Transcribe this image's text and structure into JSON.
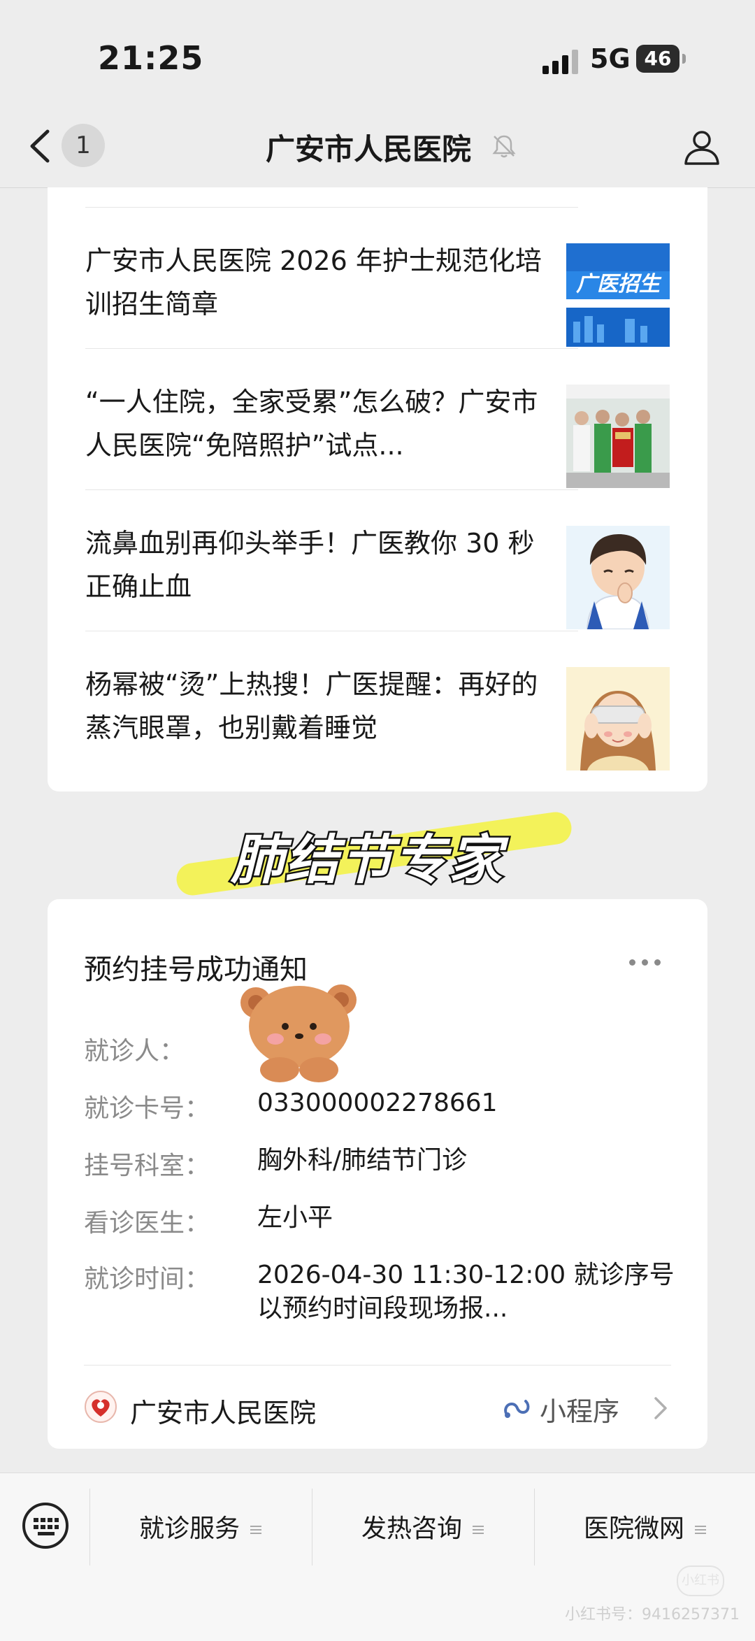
{
  "status_bar": {
    "time": "21:25",
    "network": "5G",
    "battery": "46"
  },
  "nav": {
    "unread_count": "1",
    "title": "广安市人民医院"
  },
  "articles": [
    {
      "title": "广安市人民医院 2026 年护士规范化培训招生简章",
      "thumb_text": "广医招生"
    },
    {
      "title": "“一人住院，全家受累”怎么破？广安市人民医院“免陪照护”试点..."
    },
    {
      "title": "流鼻血别再仰头举手！广医教你 30 秒正确止血"
    },
    {
      "title": "杨幂被“烫”上热搜！广医提醒：再好的蒸汽眼罩，也别戴着睡觉"
    }
  ],
  "caption": "肺结节专家",
  "notification": {
    "title": "预约挂号成功通知",
    "fields": [
      {
        "label": "就诊人：",
        "value": ""
      },
      {
        "label": "就诊卡号：",
        "value": "033000002278661"
      },
      {
        "label": "挂号科室：",
        "value": "胸外科/肺结节门诊"
      },
      {
        "label": "看诊医生：",
        "value": "左小平"
      },
      {
        "label": "就诊时间：",
        "value": "2026-04-30 11:30-12:00 就诊序号以预约时间段现场报..."
      }
    ],
    "mini_program_name": "广安市人民医院",
    "mini_program_label": "小程序"
  },
  "bottom_menu": [
    {
      "label": "就诊服务"
    },
    {
      "label": "发热咨询"
    },
    {
      "label": "医院微网"
    }
  ],
  "watermark": "小红书号：9416257371",
  "watermark_logo": "小红书",
  "colors": {
    "background": "#ededed",
    "card": "#ffffff",
    "caption_highlight": "#f3f25a",
    "label_gray": "#8a8a8a",
    "mini_link": "#4c6fb5"
  },
  "icons": [
    "back-icon",
    "mute-bell-icon",
    "profile-icon",
    "more-dots-icon",
    "hospital-logo-icon",
    "mini-program-link-icon",
    "chevron-right-icon",
    "keyboard-icon",
    "menu-list-icon"
  ]
}
